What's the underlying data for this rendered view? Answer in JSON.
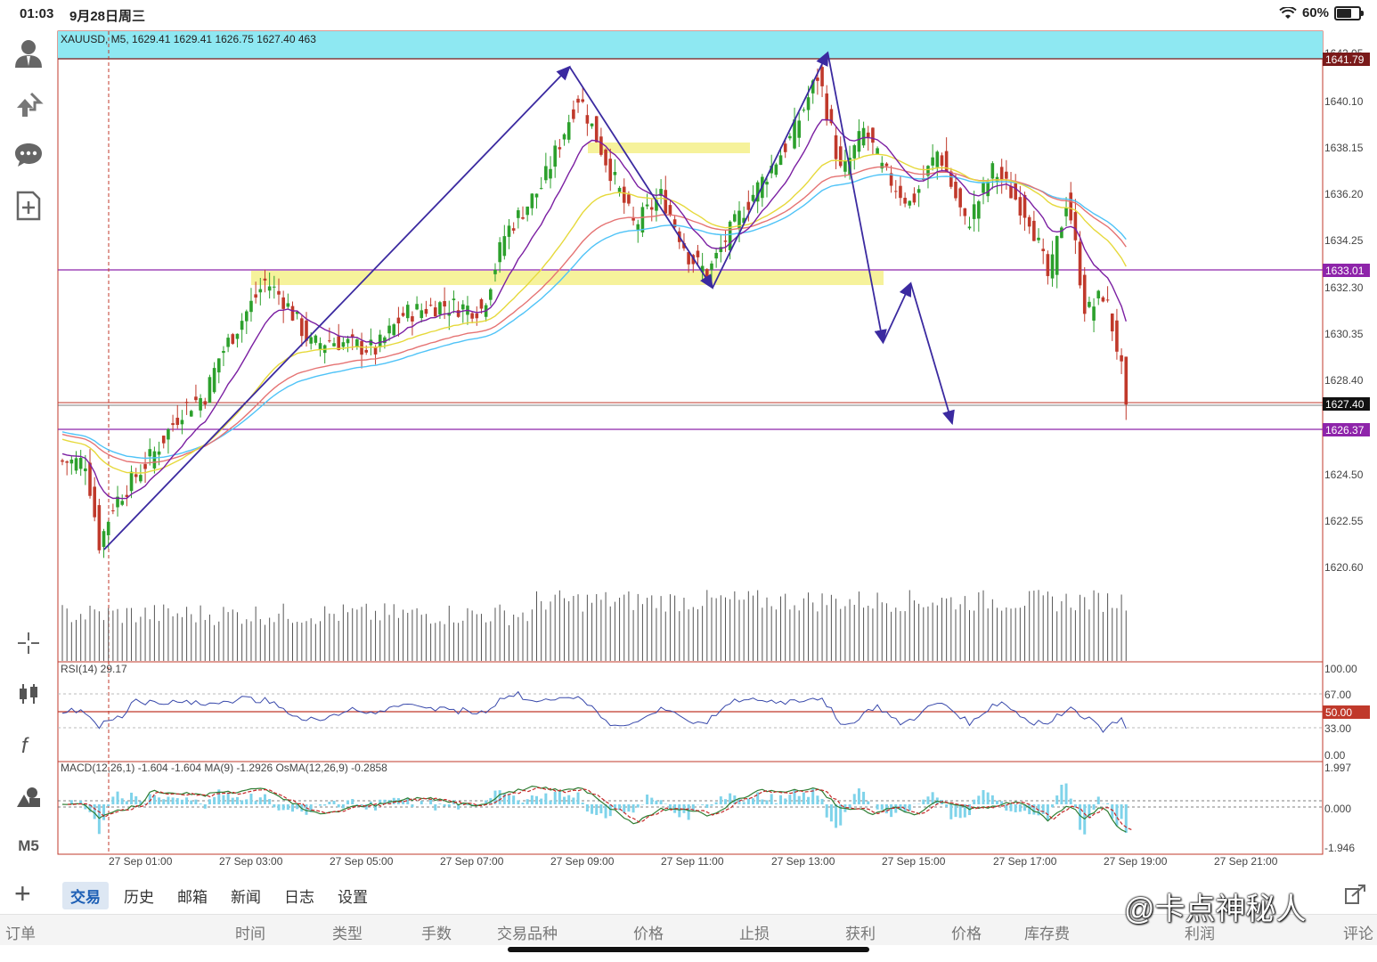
{
  "status_bar": {
    "time": "01:03",
    "date": "9月28日周三",
    "battery": "60%"
  },
  "left_toolbar": {
    "items": [
      {
        "id": "account",
        "icon": "user-icon"
      },
      {
        "id": "trade",
        "icon": "trade-arrows-icon"
      },
      {
        "id": "chat",
        "icon": "chat-bubble-icon"
      },
      {
        "id": "new-order",
        "icon": "add-document-icon"
      },
      {
        "id": "crosshair",
        "icon": "crosshair-icon"
      },
      {
        "id": "chart-type",
        "icon": "candlestick-icon"
      },
      {
        "id": "indicators",
        "icon": "function-icon"
      },
      {
        "id": "objects",
        "icon": "shapes-icon"
      }
    ],
    "timeframe": "M5"
  },
  "chart": {
    "info": "XAUUSD, M5, 1629.41 1629.41 1626.75 1627.40 463",
    "price_ticks": [
      "1640.10",
      "1638.15",
      "1636.20",
      "1634.25",
      "1632.30",
      "1630.35",
      "1628.40",
      "1624.50",
      "1622.55",
      "1620.60"
    ],
    "top_partial_tick": "1642.05",
    "price_labels": {
      "top_line": "1641.79",
      "support_line": "1633.01",
      "current": "1627.40",
      "target_line": "1626.37"
    },
    "rsi": {
      "label": "RSI(14) 29.17",
      "ticks": [
        "100.00",
        "67.00",
        "33.00",
        "0.00"
      ],
      "level_label": "50.00"
    },
    "macd": {
      "label": "MACD(12,26,1) -1.604 -1.604 MA(9) -1.2926 OsMA(12,26,9) -0.2858",
      "ticks": [
        "1.997",
        "0.000",
        "-1.946"
      ]
    },
    "time_labels": [
      "27 Sep 01:00",
      "27 Sep 03:00",
      "27 Sep 05:00",
      "27 Sep 07:00",
      "27 Sep 09:00",
      "27 Sep 11:00",
      "27 Sep 13:00",
      "27 Sep 15:00",
      "27 Sep 17:00",
      "27 Sep 19:00",
      "27 Sep 21:00"
    ],
    "colors": {
      "bull": "#2ca02c",
      "bear": "#c0392b",
      "ma_fast": "#7b1fa2",
      "ma_mid": "#e6d93b",
      "ma_slow1": "#e57373",
      "ma_slow2": "#4fc3f7",
      "arrow": "#3b2aa0",
      "zone": "#f4f08a",
      "resistance_band": "#8ee8f2"
    }
  },
  "chart_data": {
    "type": "candlestick",
    "symbol": "XAUUSD",
    "timeframe": "M5",
    "last": {
      "open": 1629.41,
      "high": 1629.41,
      "low": 1626.75,
      "close": 1627.4,
      "volume": 463
    },
    "ylim": [
      1619.5,
      1642.5
    ],
    "levels": [
      1641.79,
      1633.01,
      1627.4,
      1626.37
    ],
    "close_path": [
      {
        "t": "27 Sep 00:35",
        "p": 1625.0
      },
      {
        "t": "27 Sep 00:50",
        "p": 1621.5
      },
      {
        "t": "27 Sep 01:05",
        "p": 1623.2
      },
      {
        "t": "27 Sep 01:50",
        "p": 1625.4
      },
      {
        "t": "27 Sep 02:20",
        "p": 1627.2
      },
      {
        "t": "27 Sep 02:45",
        "p": 1627.8
      },
      {
        "t": "27 Sep 03:00",
        "p": 1629.4
      },
      {
        "t": "27 Sep 03:50",
        "p": 1632.6
      },
      {
        "t": "27 Sep 04:10",
        "p": 1631.8
      },
      {
        "t": "27 Sep 04:40",
        "p": 1629.9
      },
      {
        "t": "27 Sep 05:00",
        "p": 1630.1
      },
      {
        "t": "27 Sep 05:50",
        "p": 1629.7
      },
      {
        "t": "27 Sep 06:20",
        "p": 1631.2
      },
      {
        "t": "27 Sep 07:00",
        "p": 1631.6
      },
      {
        "t": "27 Sep 07:45",
        "p": 1631.4
      },
      {
        "t": "27 Sep 08:10",
        "p": 1634.6
      },
      {
        "t": "27 Sep 08:50",
        "p": 1636.6
      },
      {
        "t": "27 Sep 09:30",
        "p": 1640.4
      },
      {
        "t": "27 Sep 10:00",
        "p": 1637.6
      },
      {
        "t": "27 Sep 10:30",
        "p": 1634.9
      },
      {
        "t": "27 Sep 11:00",
        "p": 1636.2
      },
      {
        "t": "27 Sep 11:30",
        "p": 1633.6
      },
      {
        "t": "27 Sep 11:50",
        "p": 1632.9
      },
      {
        "t": "27 Sep 12:10",
        "p": 1634.4
      },
      {
        "t": "27 Sep 12:40",
        "p": 1636.3
      },
      {
        "t": "27 Sep 13:20",
        "p": 1638.6
      },
      {
        "t": "27 Sep 13:50",
        "p": 1641.3
      },
      {
        "t": "27 Sep 14:15",
        "p": 1637.0
      },
      {
        "t": "27 Sep 14:40",
        "p": 1639.0
      },
      {
        "t": "27 Sep 15:00",
        "p": 1637.2
      },
      {
        "t": "27 Sep 15:30",
        "p": 1635.8
      },
      {
        "t": "27 Sep 16:00",
        "p": 1638.1
      },
      {
        "t": "27 Sep 16:30",
        "p": 1634.9
      },
      {
        "t": "27 Sep 17:00",
        "p": 1637.3
      },
      {
        "t": "27 Sep 17:40",
        "p": 1635.2
      },
      {
        "t": "27 Sep 18:00",
        "p": 1632.6
      },
      {
        "t": "27 Sep 18:20",
        "p": 1636.2
      },
      {
        "t": "27 Sep 18:40",
        "p": 1631.2
      },
      {
        "t": "27 Sep 19:00",
        "p": 1632.1
      },
      {
        "t": "27 Sep 19:15",
        "p": 1629.6
      },
      {
        "t": "27 Sep 19:25",
        "p": 1627.4
      }
    ],
    "drawn_path_up": [
      {
        "t": "27 Sep 00:55",
        "p": 1621.3
      },
      {
        "t": "27 Sep 09:20",
        "p": 1641.6
      },
      {
        "t": "27 Sep 11:55",
        "p": 1632.3
      },
      {
        "t": "27 Sep 14:00",
        "p": 1642.2
      }
    ],
    "drawn_path_projection": [
      {
        "t": "27 Sep 14:00",
        "p": 1642.2
      },
      {
        "t": "27 Sep 15:00",
        "p": 1630.0
      },
      {
        "t": "27 Sep 15:30",
        "p": 1632.5
      },
      {
        "t": "27 Sep 16:15",
        "p": 1626.6
      }
    ]
  },
  "tabs": [
    "交易",
    "历史",
    "邮箱",
    "新闻",
    "日志",
    "设置"
  ],
  "active_tab": "交易",
  "columns": [
    "订单",
    "时间",
    "类型",
    "手数",
    "交易品种",
    "价格",
    "止损",
    "获利",
    "价格",
    "库存费",
    "利润",
    "评论"
  ],
  "watermark": "@卡点神秘人"
}
